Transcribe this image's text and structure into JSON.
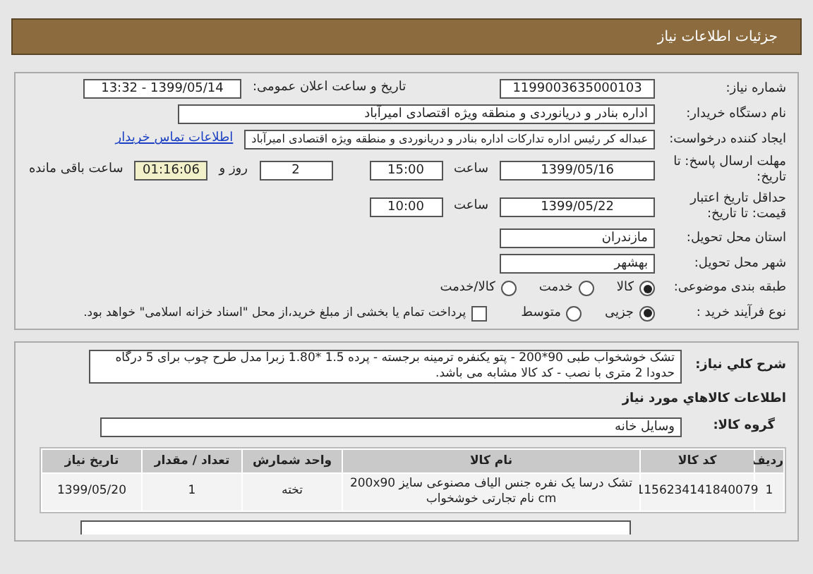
{
  "header": {
    "title": "جزئیات اطلاعات نیاز"
  },
  "need_number": {
    "label": "شماره نیاز:",
    "value": "1199003635000103"
  },
  "announce": {
    "label": "تاریخ و ساعت اعلان عمومی:",
    "value": "1399/05/14 - 13:32"
  },
  "buyer": {
    "label": "نام دستگاه خریدار:",
    "value": "اداره بنادر و دریانوردی و منطقه ویژه اقتصادی امیرآباد"
  },
  "creator": {
    "label": "ایجاد کننده درخواست:",
    "value": "عبداله کر رئیس اداره تدارکات اداره بنادر و دریانوردی و منطقه ویژه اقتصادی امیرآباد",
    "link": "اطلاعات تماس خریدار"
  },
  "deadline": {
    "label": "مهلت ارسال پاسخ: تا تاریخ:",
    "date": "1399/05/16",
    "time_label": "ساعت",
    "time": "15:00",
    "days": "2",
    "days_label": "روز و",
    "remaining": "01:16:06",
    "remaining_label": "ساعت باقی مانده"
  },
  "validity": {
    "label": "حداقل تاریخ اعتبار قیمت: تا تاریخ:",
    "date": "1399/05/22",
    "time_label": "ساعت",
    "time": "10:00"
  },
  "province": {
    "label": "استان محل تحویل:",
    "value": "مازندران"
  },
  "city": {
    "label": "شهر محل تحویل:",
    "value": "بهشهر"
  },
  "category": {
    "label": "طبقه بندی موضوعی:",
    "options": [
      {
        "label": "کالا",
        "selected": true
      },
      {
        "label": "خدمت",
        "selected": false
      },
      {
        "label": "کالا/خدمت",
        "selected": false
      }
    ]
  },
  "process": {
    "label": "نوع فرآیند خرید :",
    "options": [
      {
        "label": "جزیی",
        "selected": true
      },
      {
        "label": "متوسط",
        "selected": false
      }
    ],
    "treasury": {
      "label": "پرداخت تمام یا بخشی از مبلغ خرید،از محل \"اسناد خزانه اسلامی\" خواهد بود.",
      "checked": false
    }
  },
  "description": {
    "label": "شرح کلي نياز:",
    "value": "تشک خوشخواب طبی 90*200 - پتو یکنفره ترمینه برجسته - پرده 1.5 *1.80 زبرا مدل طرح چوب برای 5 درگاه حدودا 2 متری با نصب - کد کالا مشابه می باشد."
  },
  "goods_title": "اطلاعات کالاهاي مورد نياز",
  "goods_group": {
    "label": "گروه کالا:",
    "value": "وسایل خانه"
  },
  "table": {
    "columns": [
      "ردیف",
      "کد کالا",
      "نام کالا",
      "واحد شمارش",
      "تعداد / مقدار",
      "تاریخ نیاز"
    ],
    "rows": [
      [
        "1",
        "1156234141840079",
        "تشک درسا یک نفره جنس الیاف مصنوعی سایز 200x90 cm نام تجارتی خوشخواب",
        "تخته",
        "1",
        "1399/05/20"
      ]
    ]
  }
}
